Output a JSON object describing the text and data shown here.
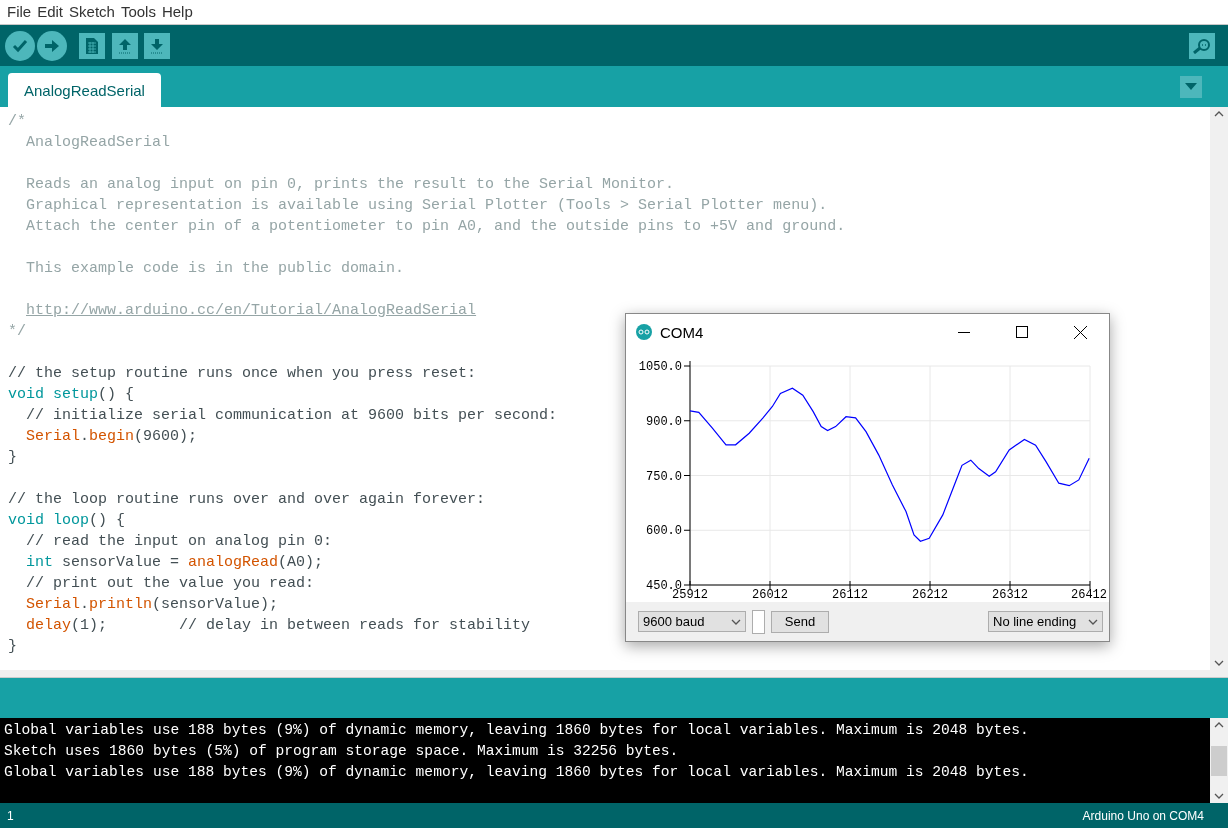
{
  "menu": [
    "File",
    "Edit",
    "Sketch",
    "Tools",
    "Help"
  ],
  "tabs": [
    {
      "label": "AnalogReadSerial",
      "selected": true
    }
  ],
  "editor": {
    "lines": [
      {
        "kind": "code",
        "tokens": [
          {
            "kind": "comment",
            "text": "/*"
          }
        ]
      },
      {
        "kind": "code",
        "tokens": [
          {
            "kind": "comment",
            "text": "  AnalogReadSerial"
          }
        ]
      },
      {
        "kind": "blank"
      },
      {
        "kind": "code",
        "tokens": [
          {
            "kind": "comment",
            "text": "  Reads an analog input on pin 0, prints the result to the Serial Monitor."
          }
        ]
      },
      {
        "kind": "code",
        "tokens": [
          {
            "kind": "comment",
            "text": "  Graphical representation is available using Serial Plotter (Tools > Serial Plotter menu)."
          }
        ]
      },
      {
        "kind": "code",
        "tokens": [
          {
            "kind": "comment",
            "text": "  Attach the center pin of a potentiometer to pin A0, and the outside pins to +5V and ground."
          }
        ]
      },
      {
        "kind": "blank"
      },
      {
        "kind": "code",
        "tokens": [
          {
            "kind": "comment",
            "text": "  This example code is in the public domain."
          }
        ]
      },
      {
        "kind": "blank"
      },
      {
        "kind": "code",
        "indented": true,
        "tokens": [
          {
            "kind": "link",
            "text": "http://www.arduino.cc/en/Tutorial/AnalogReadSerial"
          }
        ]
      },
      {
        "kind": "code",
        "tokens": [
          {
            "kind": "comment",
            "text": "*/"
          }
        ]
      },
      {
        "kind": "blank"
      },
      {
        "kind": "code",
        "tokens": [
          {
            "kind": "plain",
            "text": "// the setup routine runs once when you press reset:"
          }
        ]
      },
      {
        "kind": "code",
        "tokens": [
          {
            "kind": "keyword",
            "text": "void"
          },
          {
            "kind": "keyword",
            "text": " setup"
          },
          {
            "kind": "plain",
            "text": "() {"
          }
        ]
      },
      {
        "kind": "code",
        "tokens": [
          {
            "kind": "plain",
            "text": "  // initialize serial communication at 9600 bits per second:"
          }
        ]
      },
      {
        "kind": "code",
        "tokens": [
          {
            "kind": "function",
            "text": "  Serial"
          },
          {
            "kind": "plain",
            "text": "."
          },
          {
            "kind": "function",
            "text": "begin"
          },
          {
            "kind": "plain",
            "text": "(9600);"
          }
        ]
      },
      {
        "kind": "code",
        "tokens": [
          {
            "kind": "plain",
            "text": "}"
          }
        ]
      },
      {
        "kind": "blank"
      },
      {
        "kind": "code",
        "tokens": [
          {
            "kind": "plain",
            "text": "// the loop routine runs over and over again forever:"
          }
        ]
      },
      {
        "kind": "code",
        "tokens": [
          {
            "kind": "keyword",
            "text": "void"
          },
          {
            "kind": "keyword",
            "text": " loop"
          },
          {
            "kind": "plain",
            "text": "() {"
          }
        ]
      },
      {
        "kind": "code",
        "tokens": [
          {
            "kind": "plain",
            "text": "  // read the input on analog pin 0:"
          }
        ]
      },
      {
        "kind": "code",
        "tokens": [
          {
            "kind": "keyword",
            "text": "  int"
          },
          {
            "kind": "plain",
            "text": " sensorValue = "
          },
          {
            "kind": "function",
            "text": "analogRead"
          },
          {
            "kind": "plain",
            "text": "(A0);"
          }
        ]
      },
      {
        "kind": "code",
        "tokens": [
          {
            "kind": "plain",
            "text": "  // print out the value you read:"
          }
        ]
      },
      {
        "kind": "code",
        "tokens": [
          {
            "kind": "function",
            "text": "  Serial"
          },
          {
            "kind": "plain",
            "text": "."
          },
          {
            "kind": "function",
            "text": "println"
          },
          {
            "kind": "plain",
            "text": "(sensorValue);"
          }
        ]
      },
      {
        "kind": "code",
        "tokens": [
          {
            "kind": "function",
            "text": "  delay"
          },
          {
            "kind": "plain",
            "text": "(1);        // delay in between reads for stability"
          }
        ]
      },
      {
        "kind": "code",
        "tokens": [
          {
            "kind": "plain",
            "text": "}"
          }
        ]
      }
    ]
  },
  "plotter": {
    "title": "COM4",
    "chart_data": {
      "type": "line",
      "x": [
        25912,
        25923,
        25940,
        25957,
        25969,
        25986,
        26003,
        26015,
        26025,
        26040,
        26053,
        26066,
        26076,
        26084,
        26094,
        26107,
        26119,
        26132,
        26148,
        26165,
        26182,
        26192,
        26200,
        26211,
        26228,
        26244,
        26252,
        26263,
        26273,
        26286,
        26294,
        26311,
        26330,
        26344,
        26357,
        26373,
        26386,
        26398,
        26411
      ],
      "grid": true,
      "series": [
        {
          "color": "#0000ff",
          "values": [
            927,
            923,
            880,
            834,
            834,
            866,
            907,
            939,
            975,
            989,
            970,
            925,
            884,
            873,
            884,
            911,
            908,
            870,
            806,
            724,
            651,
            587,
            570,
            578,
            642,
            733,
            778,
            792,
            769,
            748,
            760,
            820,
            849,
            833,
            788,
            729,
            722,
            738,
            797
          ]
        }
      ],
      "xlim": [
        25912,
        26412
      ],
      "ylim": [
        450,
        1050
      ],
      "xticks": [
        25912,
        26012,
        26112,
        26212,
        26312,
        26412
      ],
      "yticks": [
        {
          "value": 450,
          "label": "450.0"
        },
        {
          "value": 600,
          "label": "600.0"
        },
        {
          "value": 750,
          "label": "750.0"
        },
        {
          "value": 900,
          "label": "900.0"
        },
        {
          "value": 1050,
          "label": "1050.0"
        }
      ]
    },
    "baud": "9600 baud",
    "send": "Send",
    "line_ending": "No line ending"
  },
  "console": {
    "lines": [
      "Global variables use 188 bytes (9%) of dynamic memory, leaving 1860 bytes for local variables. Maximum is 2048 bytes.",
      "Sketch uses 1860 bytes (5%) of program storage space. Maximum is 32256 bytes.",
      "Global variables use 188 bytes (9%) of dynamic memory, leaving 1860 bytes for local variables. Maximum is 2048 bytes."
    ]
  },
  "status_bar": {
    "line": "1",
    "board": "Arduino Uno on COM4"
  }
}
